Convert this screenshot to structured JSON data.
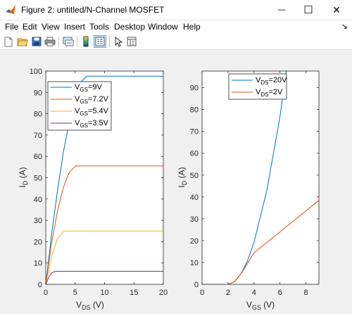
{
  "window": {
    "title": "Figure 2: untitled/N-Channel MOSFET",
    "minimize_glyph": "—",
    "maximize_glyph": "☐",
    "close_glyph": "✕"
  },
  "menu": [
    "File",
    "Edit",
    "View",
    "Insert",
    "Tools",
    "Desktop",
    "Window",
    "Help"
  ],
  "menu_pin_glyph": "↘",
  "toolbar": [
    "new-figure-icon",
    "open-file-icon",
    "save-icon",
    "print-icon",
    "link-icon",
    "insert-colorbar-icon",
    "insert-legend-icon",
    "edit-plot-icon",
    "property-inspector-icon"
  ],
  "colors": {
    "blue": "#0072BD",
    "orange": "#D95319",
    "yellow": "#EDB120",
    "purple": "#7E2F8E"
  },
  "chart_data": [
    {
      "type": "line",
      "xlabel": {
        "main": "V",
        "sub": "DS",
        "unit": " (V)"
      },
      "ylabel": {
        "main": "I",
        "sub": "D",
        "unit": " (A)"
      },
      "xlim": [
        0,
        20
      ],
      "ylim": [
        0,
        100
      ],
      "xticks": [
        0,
        5,
        10,
        15,
        20
      ],
      "yticks": [
        0,
        10,
        20,
        30,
        40,
        50,
        60,
        70,
        80,
        90,
        100
      ],
      "legend_position": "top-left",
      "series": [
        {
          "name": "9V",
          "legend_main": "V",
          "legend_sub": "GS",
          "legend_tail": "=9V",
          "color": "#0072BD",
          "x": [
            0,
            1,
            2,
            3,
            4,
            5,
            6,
            7,
            8,
            10,
            12,
            15,
            20
          ],
          "y": [
            0,
            23.5,
            44,
            62,
            76,
            87.5,
            95,
            97.6,
            97.6,
            97.6,
            97.6,
            97.6,
            97.6
          ]
        },
        {
          "name": "7.2V",
          "legend_main": "V",
          "legend_sub": "GS",
          "legend_tail": "=7.2V",
          "color": "#D95319",
          "x": [
            0,
            1,
            2,
            3,
            4,
            5,
            5.2,
            6,
            8,
            10,
            15,
            20
          ],
          "y": [
            0,
            19.5,
            34.5,
            45.5,
            52.5,
            55.3,
            55.5,
            55.5,
            55.5,
            55.5,
            55.5,
            55.5
          ]
        },
        {
          "name": "5.4V",
          "legend_main": "V",
          "legend_sub": "GS",
          "legend_tail": "=5.4V",
          "color": "#EDB120",
          "x": [
            0,
            1,
            2,
            3,
            3.4,
            4,
            6,
            10,
            15,
            20
          ],
          "y": [
            0,
            13,
            21.5,
            24.7,
            25,
            25,
            25,
            25,
            25,
            25
          ]
        },
        {
          "name": "3.5V",
          "legend_main": "V",
          "legend_sub": "GS",
          "legend_tail": "=3.5V",
          "color": "#7E2F8E",
          "x": [
            0,
            0.5,
            1,
            1.5,
            2,
            3,
            5,
            10,
            15,
            20
          ],
          "y": [
            0,
            3.3,
            5.3,
            6,
            6.1,
            6.1,
            6.1,
            6.1,
            6.1,
            6.1
          ]
        }
      ]
    },
    {
      "type": "line",
      "xlabel": {
        "main": "V",
        "sub": "GS",
        "unit": " (V)"
      },
      "ylabel": {
        "main": "I",
        "sub": "D",
        "unit": " (A)"
      },
      "xlim": [
        0,
        9
      ],
      "ylim": [
        0,
        97.6
      ],
      "xticks": [
        0,
        2,
        4,
        6,
        8
      ],
      "yticks": [
        0,
        10,
        20,
        30,
        40,
        50,
        60,
        70,
        80,
        90
      ],
      "legend_position": "top-center",
      "series": [
        {
          "name": "20V",
          "legend_main": "V",
          "legend_sub": "DS",
          "legend_tail": "=20V",
          "color": "#0072BD",
          "x": [
            0,
            1,
            2,
            2.5,
            3,
            3.5,
            4,
            5,
            6,
            7,
            8,
            9
          ],
          "y": [
            0,
            0,
            0,
            1.2,
            4.8,
            10.8,
            19.2,
            43.2,
            76.8,
            120,
            172.8,
            235.2
          ]
        },
        {
          "name": "2V",
          "legend_main": "V",
          "legend_sub": "DS",
          "legend_tail": "=2V",
          "color": "#D95319",
          "x": [
            0,
            1,
            2,
            2.5,
            3,
            3.5,
            4,
            5,
            6,
            7,
            8,
            9
          ],
          "y": [
            0,
            0,
            0,
            1.2,
            4.8,
            9.6,
            14.4,
            19.2,
            24,
            28.8,
            33.6,
            38.4
          ]
        }
      ]
    }
  ]
}
